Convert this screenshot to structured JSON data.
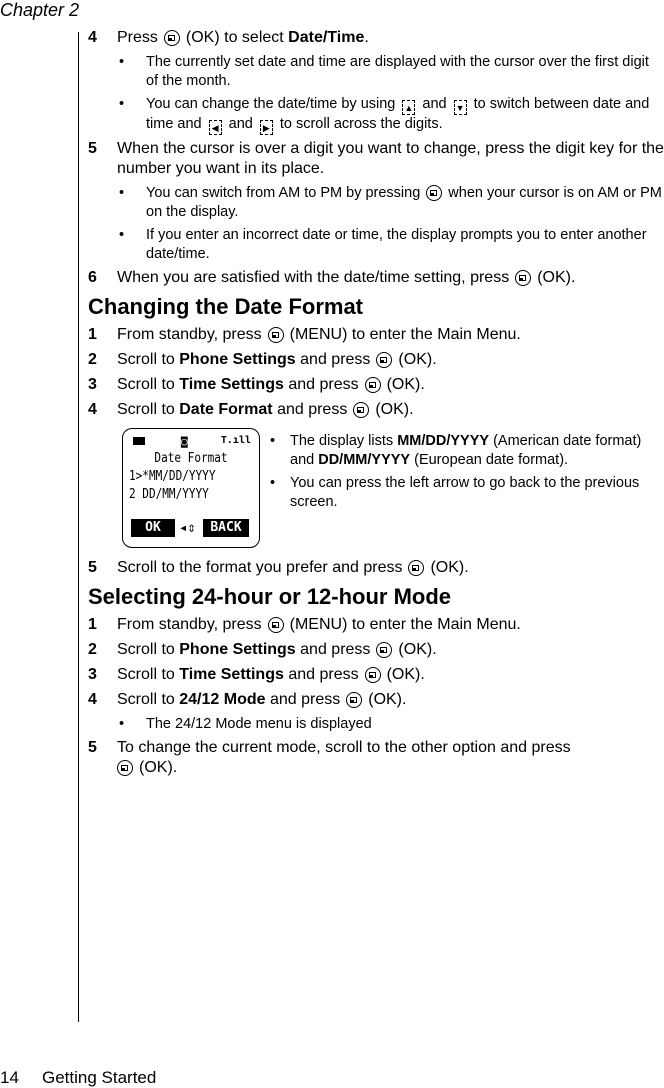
{
  "header": {
    "chapter": "Chapter 2"
  },
  "footer": {
    "page_number": "14",
    "section": "Getting Started"
  },
  "intro_steps": {
    "s4": {
      "num": "4",
      "pre": "Press",
      "key": "ok-key",
      "post": "(OK) to select",
      "bold": "Date/Time",
      "end": "."
    },
    "s4_b1": "The currently set date and time are displayed with the cursor over the first digit of the month.",
    "s4_b2": {
      "p1": "You can change the date/time by using",
      "p2": "and",
      "p3": "to switch between date and time and",
      "p4": "and",
      "p5": "to scroll across the digits."
    },
    "s5": {
      "num": "5",
      "text": "When the cursor is over a digit you want to change, press the digit key for the number you want in its place."
    },
    "s5_b1": {
      "p1": "You can switch from AM to PM by pressing",
      "p2": "when your cursor is on AM or PM on the display."
    },
    "s5_b2": "If you enter an incorrect date or time, the display prompts you to enter another date/time.",
    "s6": {
      "num": "6",
      "text": "When you are satisfied with the date/time setting, press",
      "end": "(OK)."
    }
  },
  "section1": {
    "title": "Changing the Date Format",
    "steps": [
      {
        "num": "1",
        "pre": "From standby, press",
        "bold": "",
        "post": "(MENU) to enter the Main Menu."
      },
      {
        "num": "2",
        "pre": "Scroll to",
        "bold": "Phone Settings",
        "mid": "and press",
        "post": "(OK)."
      },
      {
        "num": "3",
        "pre": "Scroll to",
        "bold": "Time Settings",
        "mid": "and press",
        "post": "(OK)."
      },
      {
        "num": "4",
        "pre": "Scroll to",
        "bold": "Date Format",
        "mid": "and press",
        "post": "(OK)."
      }
    ],
    "phone_screen": {
      "title": "Date Format",
      "line1": "1>*MM/DD/YYYY",
      "line2": "2  DD/MM/YYYY",
      "softkey_left": "OK",
      "softkey_right": "BACK",
      "nav_glyph": "◂⇕"
    },
    "figure_bullets": {
      "b1": {
        "p1": "The display lists",
        "b1": "MM/DD/YYYY",
        "p2": "(American date format) and",
        "b2": "DD/MM/YYYY",
        "p3": "(European date format)."
      },
      "b2": "You can press the left arrow to go back to the previous screen."
    },
    "step5": {
      "num": "5",
      "text": "Scroll to the format you prefer and press",
      "end": "(OK)."
    }
  },
  "section2": {
    "title": "Selecting 24-hour or 12-hour Mode",
    "steps": [
      {
        "num": "1",
        "pre": "From standby, press",
        "post": "(MENU) to enter the Main Menu."
      },
      {
        "num": "2",
        "pre": "Scroll to",
        "bold": "Phone Settings",
        "mid": "and press",
        "post": "(OK)."
      },
      {
        "num": "3",
        "pre": "Scroll to",
        "bold": "Time Settings",
        "mid": "and press",
        "post": "(OK)."
      },
      {
        "num": "4",
        "pre": "Scroll to",
        "bold": "24/12 Mode",
        "mid": "and press",
        "post": "(OK)."
      }
    ],
    "bullet": "The 24/12 Mode menu is displayed",
    "step5": {
      "num": "5",
      "text": "To change the current mode, scroll to the other option and press",
      "end": "(OK)."
    }
  },
  "icons": {
    "up": "▲",
    "down": "▼",
    "left": "◀",
    "right": "▶"
  }
}
